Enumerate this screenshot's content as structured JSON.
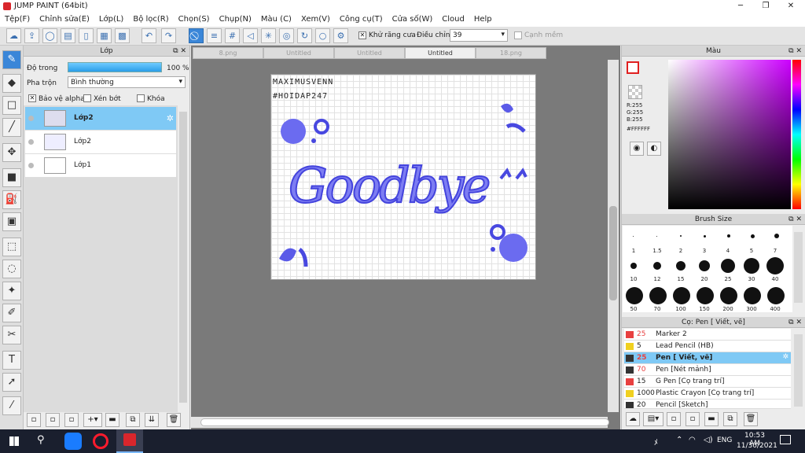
{
  "window": {
    "title": "JUMP PAINT (64bit)"
  },
  "menu": [
    "Tệp(F)",
    "Chỉnh sửa(E)",
    "Lớp(L)",
    "Bộ lọc(R)",
    "Chọn(S)",
    "Chụp(N)",
    "Màu (C)",
    "Xem(V)",
    "Công cụ(T)",
    "Cửa số(W)",
    "Cloud",
    "Help"
  ],
  "toolbar": {
    "antialias_label": "Khử răng cưa",
    "adjust_label": "Điều chỉnh",
    "adjust_value": "39",
    "smooth_label": "Cạnh mềm"
  },
  "layer_panel": {
    "title": "Lớp",
    "opacity_label": "Độ trong",
    "opacity_value": "100 %",
    "blend_label": "Pha trộn",
    "blend_value": "Bình thường",
    "protect_alpha": "Bảo vệ alpha",
    "clip": "Xén bớt",
    "lock": "Khóa",
    "layers": [
      {
        "name": "Lớp2",
        "selected": true
      },
      {
        "name": "Lớp2",
        "selected": false
      },
      {
        "name": "Lớp1",
        "selected": false
      }
    ]
  },
  "tabs": [
    {
      "label": "8.png",
      "active": false
    },
    {
      "label": "Untitled",
      "active": false
    },
    {
      "label": "Untitled",
      "active": false
    },
    {
      "label": "Untitled",
      "active": true
    },
    {
      "label": "18.png",
      "active": false
    }
  ],
  "artwork": {
    "line1": "MAXIMUSVENN",
    "line2": "#HOIDAP247",
    "word": "Goodbye"
  },
  "color_panel": {
    "title": "Màu",
    "r": "R:255",
    "g": "G:255",
    "b": "B:255",
    "hex": "#FFFFFF"
  },
  "brush_size": {
    "title": "Brush Size",
    "sizes": [
      "1",
      "1.5",
      "2",
      "3",
      "4",
      "5",
      "7",
      "10",
      "12",
      "15",
      "20",
      "25",
      "30",
      "40",
      "50",
      "70",
      "100",
      "150",
      "200",
      "300",
      "400"
    ]
  },
  "tool_panel": {
    "title": "Cọ: Pen [ Viết, vẽ]",
    "brushes": [
      {
        "size": "25",
        "name": "Marker 2",
        "color": "#e84040",
        "selected": false
      },
      {
        "size": "5",
        "name": "Lead Pencil (HB)",
        "color": "#f0d020",
        "selected": false
      },
      {
        "size": "25",
        "name": "Pen [ Viết, vẽ]",
        "color": "#333333",
        "selected": true
      },
      {
        "size": "70",
        "name": "Pen [Nét mảnh]",
        "color": "#333333",
        "selected": false
      },
      {
        "size": "15",
        "name": "G Pen [Cọ trang trí]",
        "color": "#e84040",
        "selected": false
      },
      {
        "size": "1000",
        "name": "Plastic Crayon [Cọ trang trí]",
        "color": "#f0d020",
        "selected": false
      },
      {
        "size": "20",
        "name": "Pencil [Sketch]",
        "color": "#333333",
        "selected": false
      }
    ]
  },
  "taskbar": {
    "language": "ENG",
    "time": "10:53 AM",
    "date": "11/30/2021"
  }
}
